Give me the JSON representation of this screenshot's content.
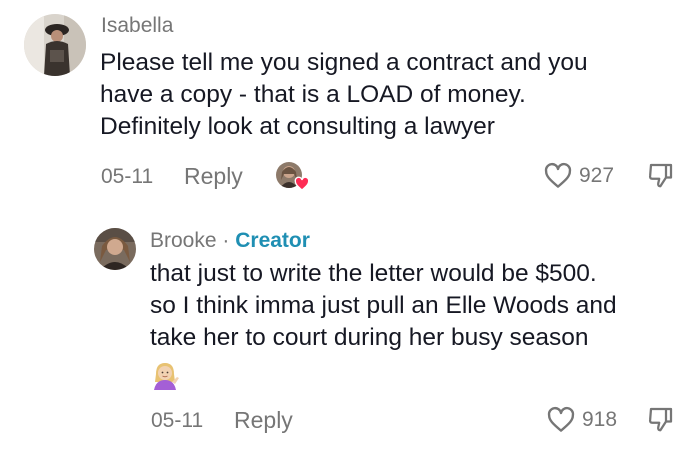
{
  "comments": [
    {
      "username": "Isabella",
      "text_lines": [
        "Please tell me you signed a contract and you",
        "have a copy - that is a LOAD of money.",
        "Definitely look at consulting a lawyer"
      ],
      "date": "05-11",
      "reply_label": "Reply",
      "likes": "927",
      "liked_by_creator": true
    },
    {
      "username": "Brooke",
      "separator": "·",
      "badge": "Creator",
      "text_lines": [
        "that just to write the letter would be $500.",
        "so I think imma just pull an Elle Woods and",
        "take her to court during her busy season"
      ],
      "emoji": "woman-tipping-hand-emoji",
      "date": "05-11",
      "reply_label": "Reply",
      "likes": "918"
    }
  ],
  "colors": {
    "text": "#161823",
    "secondary": "#767676",
    "creator_badge": "#1f8fb3",
    "heart_red": "#fe2c55"
  },
  "icons": {
    "like": "heart-outline-icon",
    "dislike": "thumbs-down-outline-icon",
    "creator_liked": "creator-liked-heart-icon"
  }
}
